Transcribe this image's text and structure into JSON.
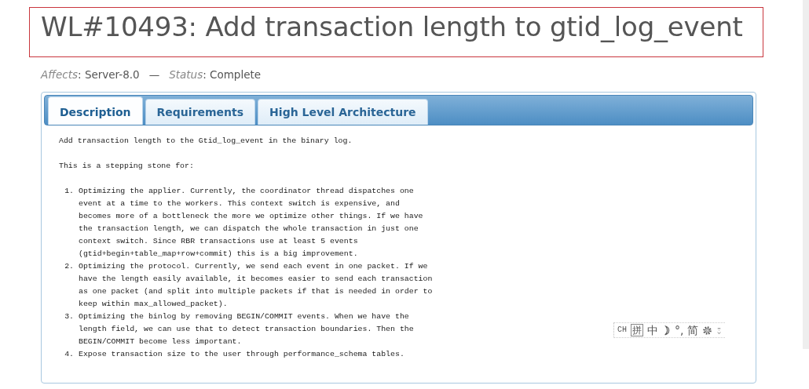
{
  "title": "WL#10493: Add transaction length to gtid_log_event",
  "meta": [
    {
      "label": "Affects",
      "value": ": Server-8.0"
    },
    {
      "label": "Status",
      "value": ": Complete"
    }
  ],
  "meta_separator": "—",
  "tabs": [
    {
      "label": "Description",
      "selected": true
    },
    {
      "label": "Requirements",
      "selected": false
    },
    {
      "label": "High Level Architecture",
      "selected": false
    }
  ],
  "description": {
    "paragraphs": [
      "Add transaction length to the Gtid_log_event in the binary log.",
      "This is a stepping stone for:"
    ],
    "list": [
      {
        "number": "1.",
        "text": "Optimizing the applier. Currently, the coordinator thread dispatches one event at a time to the workers. This context switch is expensive, and becomes more of a bottleneck the more we optimize other things. If we have the transaction length, we can dispatch the whole transaction in just one context switch. Since RBR transactions use at least 5 events (gtid+begin+table_map+row+commit) this is a big improvement."
      },
      {
        "number": "2.",
        "text": "Optimizing the protocol. Currently, we send each event in one packet. If we have the length easily available, it becomes easier to send each transaction as one packet (and split into multiple packets if that is needed in order to keep within max_allowed_packet)."
      },
      {
        "number": "3.",
        "text": "Optimizing the binlog by removing BEGIN/COMMIT events. When we have the length field, we can use that to detect transaction boundaries. Then the BEGIN/COMMIT become less important."
      },
      {
        "number": "4.",
        "text": "Expose transaction size to the user through performance_schema tables."
      }
    ]
  },
  "ime_toolbar": [
    {
      "kind": "text",
      "label": "CH"
    },
    {
      "kind": "boxed",
      "label": "拼"
    },
    {
      "kind": "text",
      "label": "中"
    },
    {
      "kind": "moon"
    },
    {
      "kind": "text",
      "label": "°,"
    },
    {
      "kind": "text",
      "label": "简"
    },
    {
      "kind": "gear"
    },
    {
      "kind": "more"
    }
  ]
}
